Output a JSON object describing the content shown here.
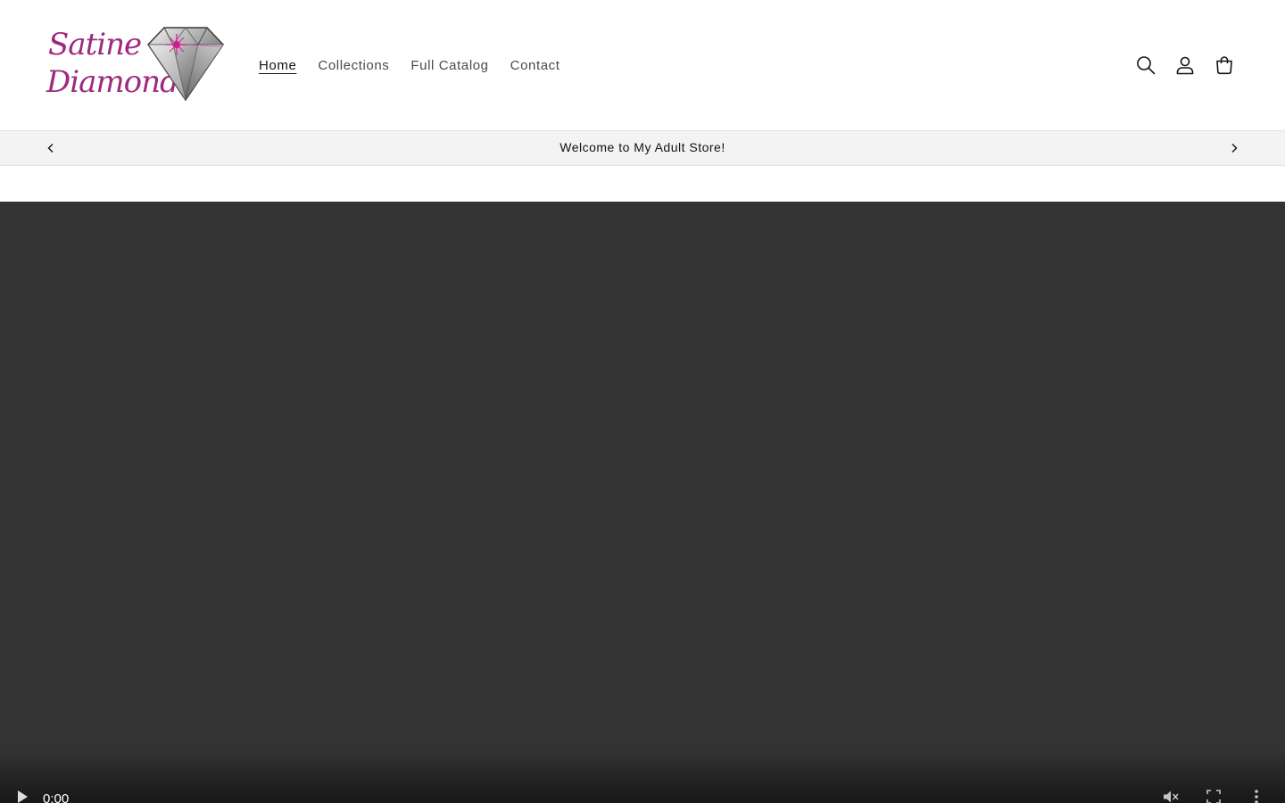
{
  "brand": {
    "name_line1": "Satine",
    "name_line2": "Diamond",
    "accent_color": "#9c2a7e"
  },
  "nav": {
    "items": [
      {
        "label": "Home",
        "active": true
      },
      {
        "label": "Collections",
        "active": false
      },
      {
        "label": "Full Catalog",
        "active": false
      },
      {
        "label": "Contact",
        "active": false
      }
    ]
  },
  "header_icons": [
    "search-icon",
    "account-icon",
    "cart-icon"
  ],
  "announcement": {
    "message": "Welcome to My Adult Store!"
  },
  "video": {
    "background": "#333333",
    "current_time": "0:00",
    "muted": true
  }
}
